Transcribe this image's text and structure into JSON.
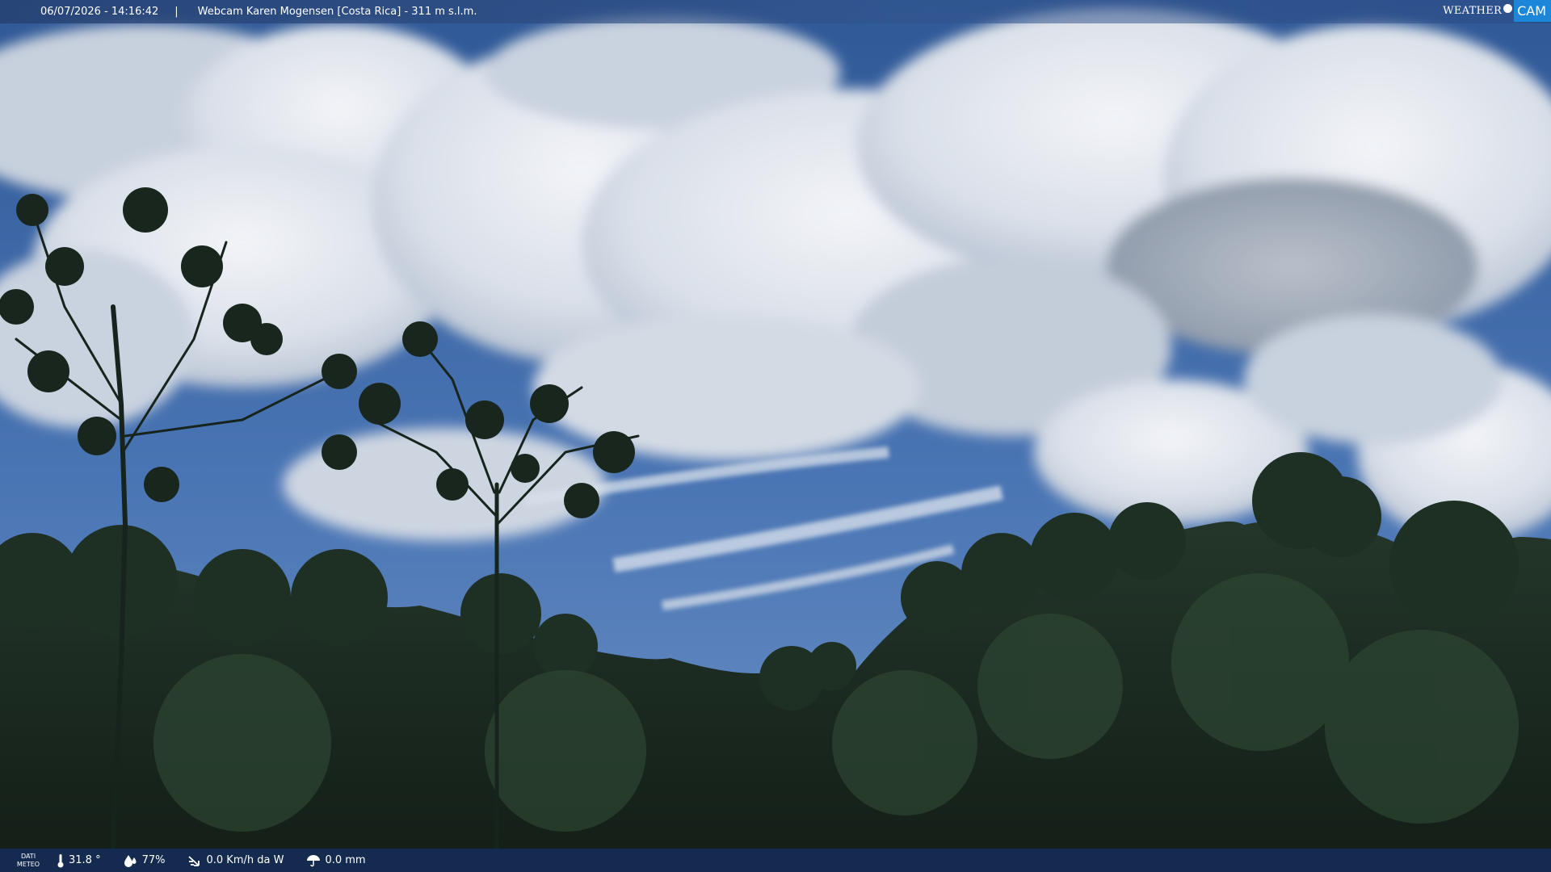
{
  "overlay": {
    "timestamp": "06/07/2026 - 14:16:42",
    "separator": "|",
    "camera": "Webcam Karen Mogensen [Costa Rica]  - 311 m s.l.m.",
    "logo_weather": "WEATHER",
    "logo_cam": "CAM"
  },
  "weather": {
    "label_line1": "DATI",
    "label_line2": "METEO",
    "temperature": "31.8 °",
    "humidity": "77%",
    "wind": "0.0 Km/h da W",
    "rain": "0.0 mm",
    "icons": [
      "thermometer-icon",
      "humidity-icon",
      "wind-icon",
      "rain-icon"
    ]
  },
  "colors": {
    "sky": "#3a63a3",
    "cloud": "#e8ecf2",
    "forest": "#1b2b21",
    "logo_accent": "#1c86d8"
  }
}
